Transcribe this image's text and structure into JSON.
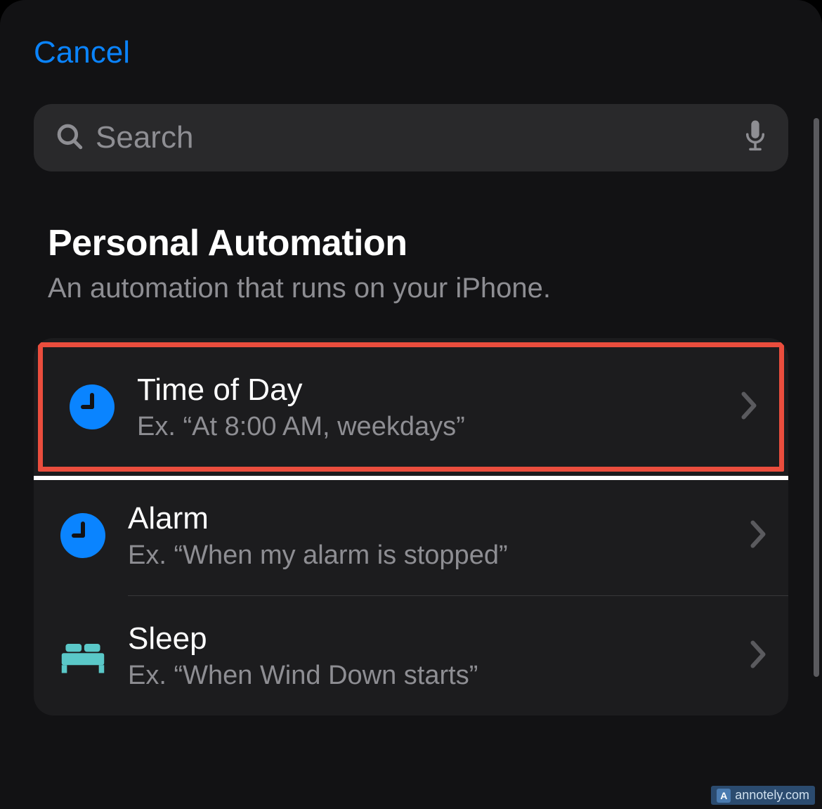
{
  "nav": {
    "cancel": "Cancel"
  },
  "search": {
    "placeholder": "Search"
  },
  "section": {
    "title": "Personal Automation",
    "subtitle": "An automation that runs on your iPhone."
  },
  "rows": [
    {
      "title": "Time of Day",
      "sub": "Ex. “At 8:00 AM, weekdays”"
    },
    {
      "title": "Alarm",
      "sub": "Ex. “When my alarm is stopped”"
    },
    {
      "title": "Sleep",
      "sub": "Ex. “When Wind Down starts”"
    }
  ],
  "watermark": "annotely.com"
}
